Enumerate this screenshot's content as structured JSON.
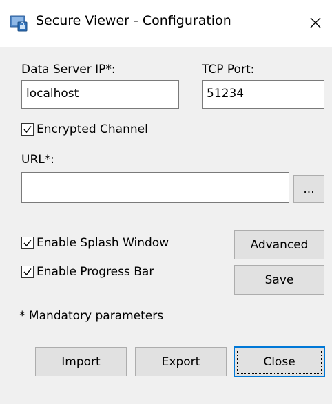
{
  "window": {
    "title": "Secure Viewer - Configuration"
  },
  "server": {
    "ip_label": "Data Server IP*:",
    "ip_value": "localhost",
    "port_label": "TCP Port:",
    "port_value": "51234"
  },
  "encrypted": {
    "label": "Encrypted Channel",
    "checked": true
  },
  "url": {
    "label": "URL*:",
    "value": "",
    "browse_label": "..."
  },
  "options": {
    "splash": {
      "label": "Enable Splash Window",
      "checked": true
    },
    "progress": {
      "label": "Enable Progress Bar",
      "checked": true
    }
  },
  "buttons": {
    "advanced": "Advanced",
    "save": "Save",
    "import": "Import",
    "export": "Export",
    "close": "Close"
  },
  "note": "* Mandatory parameters"
}
